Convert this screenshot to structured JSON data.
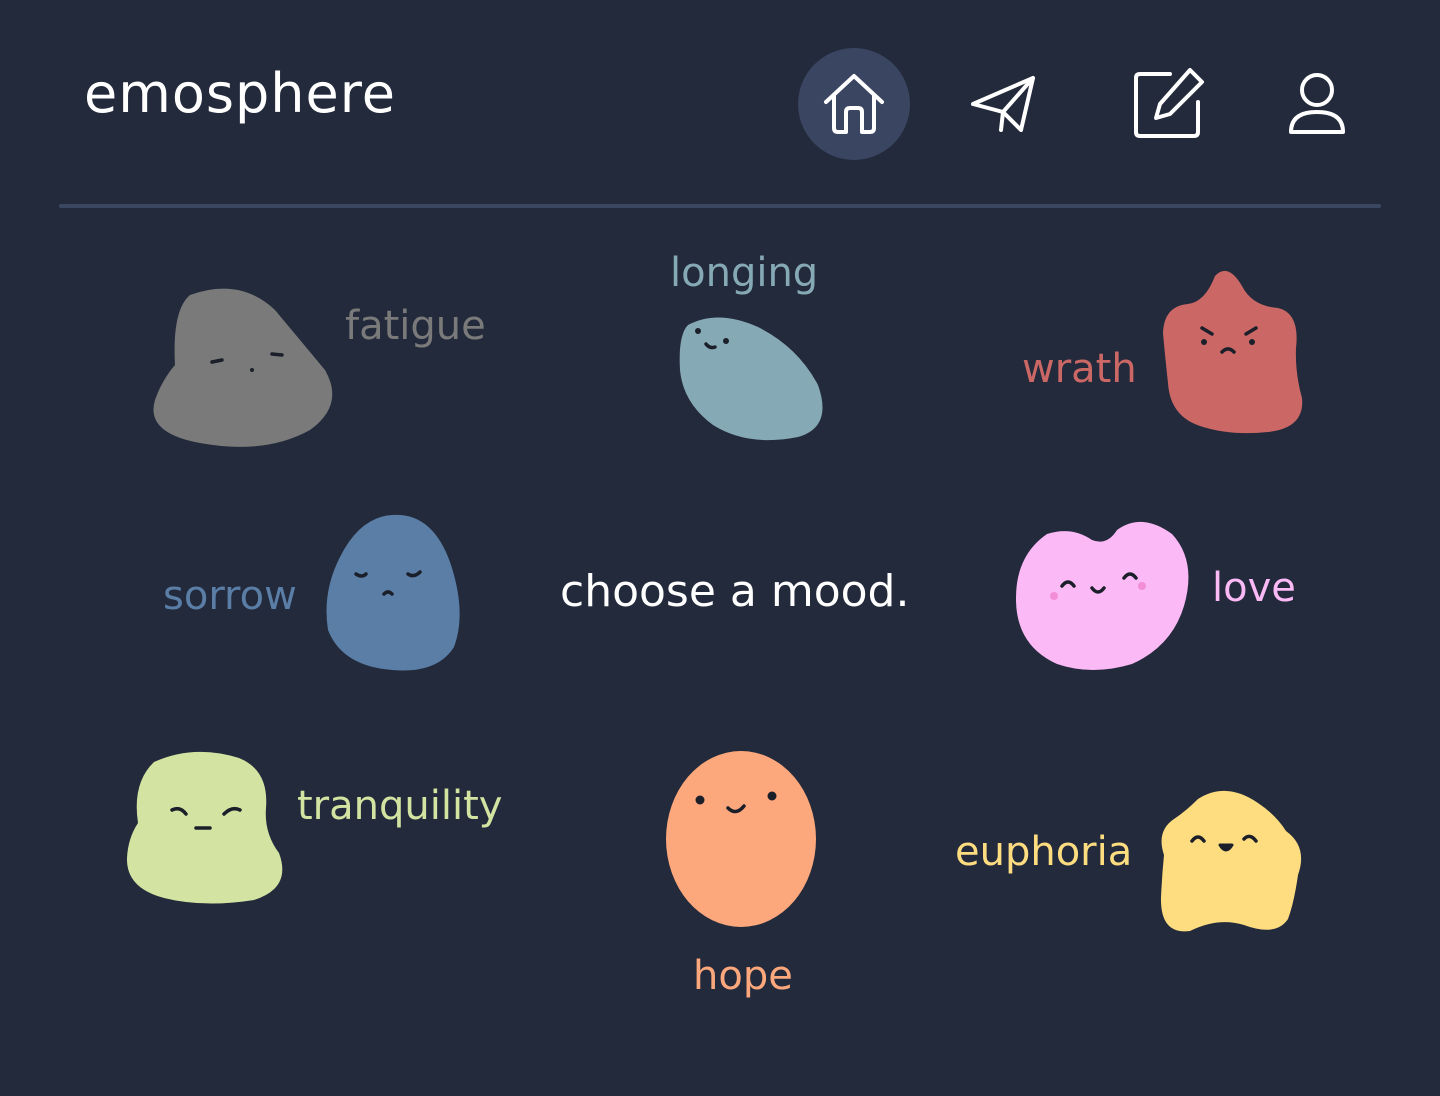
{
  "app": {
    "title": "emosphere"
  },
  "nav": {
    "items": [
      {
        "name": "home",
        "icon": "home-icon",
        "active": true
      },
      {
        "name": "send",
        "icon": "paper-plane-icon",
        "active": false
      },
      {
        "name": "compose",
        "icon": "edit-icon",
        "active": false
      },
      {
        "name": "profile",
        "icon": "user-icon",
        "active": false
      }
    ]
  },
  "prompt": "choose a mood.",
  "moods": {
    "fatigue": {
      "label": "fatigue",
      "color": "#7a7a7a"
    },
    "longing": {
      "label": "longing",
      "color": "#86a9b6"
    },
    "wrath": {
      "label": "wrath",
      "color": "#cb6866"
    },
    "sorrow": {
      "label": "sorrow",
      "color": "#5a7ea6"
    },
    "love": {
      "label": "love",
      "color": "#fbb9f6"
    },
    "tranquility": {
      "label": "tranquility",
      "color": "#d3e4a2"
    },
    "hope": {
      "label": "hope",
      "color": "#fda87c"
    },
    "euphoria": {
      "label": "euphoria",
      "color": "#fddd80"
    }
  },
  "colors": {
    "background": "#232a3b",
    "nav_active": "#3a4561",
    "divider": "#3b4761"
  }
}
